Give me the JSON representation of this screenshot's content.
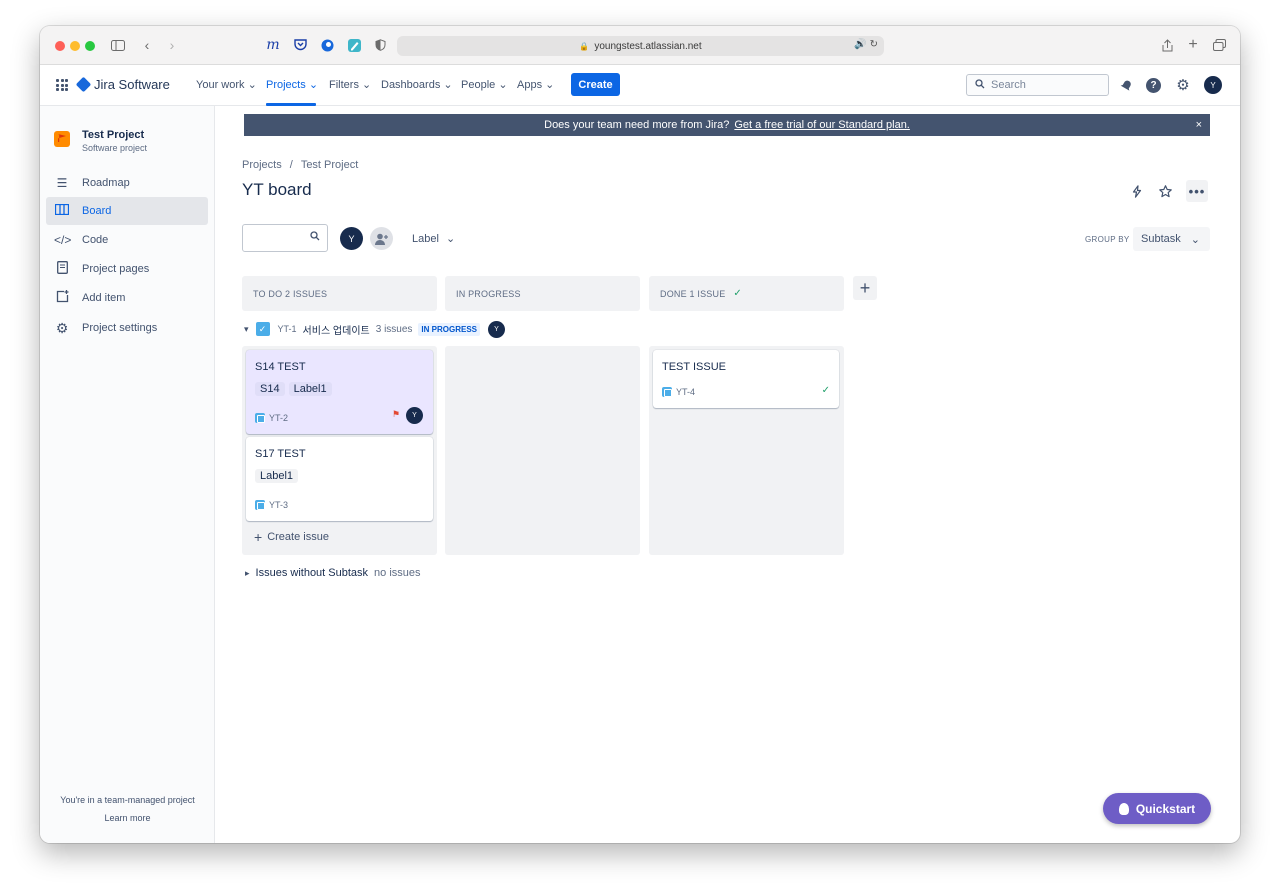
{
  "browser": {
    "url": "youngstest.atlassian.net"
  },
  "topnav": {
    "product": "Jira Software",
    "items": [
      "Your work",
      "Projects",
      "Filters",
      "Dashboards",
      "People",
      "Apps"
    ],
    "active": "Projects",
    "create_label": "Create",
    "search_placeholder": "Search",
    "user_initial": "Y"
  },
  "sidebar": {
    "project_name": "Test Project",
    "project_type": "Software project",
    "items": [
      {
        "label": "Roadmap",
        "icon": "roadmap-icon"
      },
      {
        "label": "Board",
        "icon": "board-icon"
      },
      {
        "label": "Code",
        "icon": "code-icon"
      },
      {
        "label": "Project pages",
        "icon": "pages-icon"
      },
      {
        "label": "Add item",
        "icon": "add-item-icon"
      },
      {
        "label": "Project settings",
        "icon": "settings-icon"
      }
    ],
    "active_item": "Board",
    "footer_text": "You're in a team-managed project",
    "learn_more": "Learn more"
  },
  "banner": {
    "text": "Does your team need more from Jira?",
    "link": "Get a free trial of our Standard plan.",
    "close": "×"
  },
  "breadcrumb": [
    "Projects",
    "/",
    "Test Project"
  ],
  "page_title": "YT board",
  "filters": {
    "avatar_initial": "Y",
    "label_filter": "Label",
    "group_by_label": "GROUP BY",
    "group_by_value": "Subtask"
  },
  "columns": [
    {
      "title": "TO DO 2 ISSUES"
    },
    {
      "title": "IN PROGRESS"
    },
    {
      "title": "DONE 1 ISSUE"
    }
  ],
  "parent": {
    "key": "YT-1",
    "title": "서비스 업데이트",
    "count": "3 issues",
    "status": "IN PROGRESS",
    "assignee": "Y"
  },
  "cards": {
    "c1": {
      "title": "S14 TEST",
      "labels": [
        "S14",
        "Label1"
      ],
      "key": "YT-2",
      "assignee": "Y"
    },
    "c2": {
      "title": "S17 TEST",
      "labels": [
        "Label1"
      ],
      "key": "YT-3"
    },
    "c3": {
      "title": "TEST ISSUE",
      "key": "YT-4"
    }
  },
  "create_issue": "Create issue",
  "without_group": {
    "label": "Issues without Subtask",
    "count": "no issues"
  },
  "quickstart": "Quickstart",
  "colors": {
    "primary": "#0c66e4",
    "selected_card": "#eae6ff",
    "quickstart": "#6e5dc6",
    "banner": "#44546f"
  }
}
